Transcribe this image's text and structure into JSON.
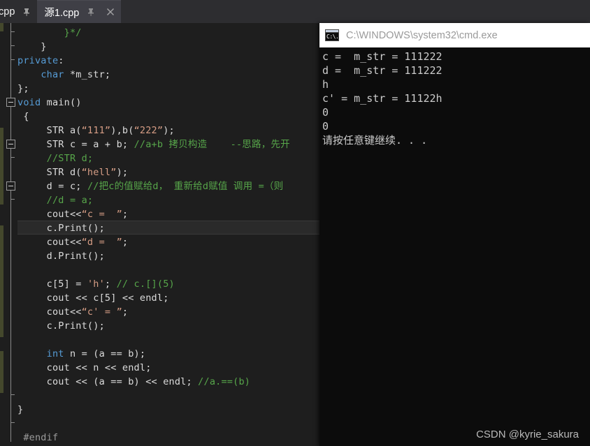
{
  "tabs": [
    {
      "label": "cpp",
      "icons": [
        "pin-icon"
      ],
      "active": false
    },
    {
      "label": "源1.cpp",
      "icons": [
        "pin-icon",
        "close-icon"
      ],
      "active": true
    }
  ],
  "editor": {
    "current_line_index": 14,
    "lines": [
      {
        "segments": [
          {
            "t": "        ",
            "c": "pl"
          },
          {
            "t": "}*/",
            "c": "cmt"
          }
        ]
      },
      {
        "segments": [
          {
            "t": "    }",
            "c": "pl"
          }
        ]
      },
      {
        "segments": [
          {
            "t": "private",
            "c": "kw"
          },
          {
            "t": ":",
            "c": "pl"
          }
        ]
      },
      {
        "segments": [
          {
            "t": "    ",
            "c": "pl"
          },
          {
            "t": "char",
            "c": "kw"
          },
          {
            "t": " *m_str;",
            "c": "pl"
          }
        ]
      },
      {
        "segments": [
          {
            "t": "};",
            "c": "pl"
          }
        ]
      },
      {
        "segments": [
          {
            "t": "void",
            "c": "kw"
          },
          {
            "t": " main()",
            "c": "pl"
          }
        ]
      },
      {
        "segments": [
          {
            "t": " {",
            "c": "pl"
          }
        ]
      },
      {
        "segments": [
          {
            "t": "     STR a(",
            "c": "pl"
          },
          {
            "t": "“111”",
            "c": "str"
          },
          {
            "t": "),b(",
            "c": "pl"
          },
          {
            "t": "“222”",
            "c": "str"
          },
          {
            "t": ");",
            "c": "pl"
          }
        ]
      },
      {
        "segments": [
          {
            "t": "     STR c = a + b; ",
            "c": "pl"
          },
          {
            "t": "//a+b 拷贝构造    --思路，先开",
            "c": "cmt"
          }
        ]
      },
      {
        "segments": [
          {
            "t": "     ",
            "c": "pl"
          },
          {
            "t": "//STR d;",
            "c": "cmt"
          }
        ]
      },
      {
        "segments": [
          {
            "t": "     STR d(",
            "c": "pl"
          },
          {
            "t": "“hell”",
            "c": "str"
          },
          {
            "t": ");",
            "c": "pl"
          }
        ]
      },
      {
        "segments": [
          {
            "t": "     d = c; ",
            "c": "pl"
          },
          {
            "t": "//把c的值赋给d， 重新给d赋值 调用 =（则",
            "c": "cmt"
          }
        ]
      },
      {
        "segments": [
          {
            "t": "     ",
            "c": "pl"
          },
          {
            "t": "//d = a;",
            "c": "cmt"
          }
        ]
      },
      {
        "segments": [
          {
            "t": "     cout<<",
            "c": "pl"
          },
          {
            "t": "“c =  ”",
            "c": "str"
          },
          {
            "t": ";",
            "c": "pl"
          }
        ]
      },
      {
        "segments": [
          {
            "t": "     c.Print();",
            "c": "pl"
          }
        ]
      },
      {
        "segments": [
          {
            "t": "     cout<<",
            "c": "pl"
          },
          {
            "t": "“d =  ”",
            "c": "str"
          },
          {
            "t": ";",
            "c": "pl"
          }
        ]
      },
      {
        "segments": [
          {
            "t": "     d.Print();",
            "c": "pl"
          }
        ]
      },
      {
        "segments": [
          {
            "t": "",
            "c": "pl"
          }
        ]
      },
      {
        "segments": [
          {
            "t": "     c[5] = ",
            "c": "pl"
          },
          {
            "t": "'h'",
            "c": "str"
          },
          {
            "t": "; ",
            "c": "pl"
          },
          {
            "t": "// c.[](5)",
            "c": "cmt"
          }
        ]
      },
      {
        "segments": [
          {
            "t": "     cout << c[5] << endl;",
            "c": "pl"
          }
        ]
      },
      {
        "segments": [
          {
            "t": "     cout<<",
            "c": "pl"
          },
          {
            "t": "“c' = ”",
            "c": "str"
          },
          {
            "t": ";",
            "c": "pl"
          }
        ]
      },
      {
        "segments": [
          {
            "t": "     c.Print();",
            "c": "pl"
          }
        ]
      },
      {
        "segments": [
          {
            "t": "",
            "c": "pl"
          }
        ]
      },
      {
        "segments": [
          {
            "t": "     ",
            "c": "pl"
          },
          {
            "t": "int",
            "c": "kw"
          },
          {
            "t": " n = (a == b);",
            "c": "pl"
          }
        ]
      },
      {
        "segments": [
          {
            "t": "     cout << n << endl;",
            "c": "pl"
          }
        ]
      },
      {
        "segments": [
          {
            "t": "     cout << (a == b) << endl; ",
            "c": "pl"
          },
          {
            "t": "//a.==(b)",
            "c": "cmt"
          }
        ]
      },
      {
        "segments": [
          {
            "t": "",
            "c": "pl"
          }
        ]
      },
      {
        "segments": [
          {
            "t": "}",
            "c": "pl"
          }
        ]
      },
      {
        "segments": [
          {
            "t": "",
            "c": "pl"
          }
        ]
      },
      {
        "segments": [
          {
            "t": " #endif",
            "c": "pp"
          }
        ]
      }
    ],
    "fold_boxes_at_lines": [
      5,
      8,
      11
    ],
    "fold_ticks_at_lines": [
      0,
      1,
      2,
      9,
      12,
      26,
      28
    ],
    "change_bar_color": "#44482c"
  },
  "console": {
    "title": "C:\\WINDOWS\\system32\\cmd.exe",
    "icon": "cmd-icon",
    "icon_text": "C:\\.",
    "lines": [
      "c =  m_str = 111222",
      "d =  m_str = 111222",
      "h",
      "c' = m_str = 11122h",
      "0",
      "0",
      "请按任意键继续. . ."
    ]
  },
  "watermark": {
    "text": "CSDN @kyrie_sakura"
  },
  "colors": {
    "editor_bg": "#1e1e1e",
    "tabstrip_bg": "#2d2d30",
    "active_tab_bg": "#3f3f46",
    "keyword": "#569cd6",
    "string": "#d69d85",
    "comment": "#57a64a",
    "plain_text": "#dcdcdc",
    "console_bg": "#0c0c0c",
    "console_titlebar": "#ffffff",
    "current_line": "#2a2a2a"
  }
}
